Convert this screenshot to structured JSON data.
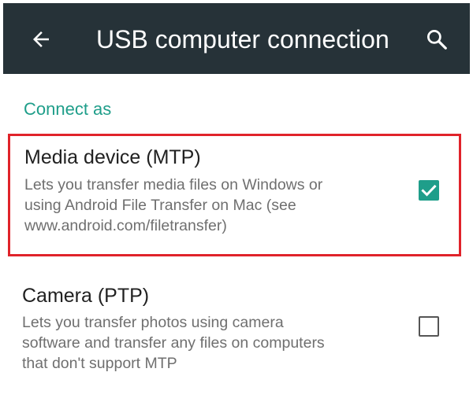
{
  "app_bar": {
    "title": "USB computer connection",
    "back_icon": "arrow-back-icon",
    "search_icon": "search-icon",
    "background_color": "#263238"
  },
  "section": {
    "header": "Connect as",
    "accent_color": "#1f9e8a"
  },
  "options": [
    {
      "title": "Media device (MTP)",
      "description": "Lets you transfer media files on Windows or\nusing Android File Transfer on Mac (see\nwww.android.com/filetransfer)",
      "checked": true,
      "highlighted": true,
      "highlight_color": "#e0232a"
    },
    {
      "title": "Camera (PTP)",
      "description": "Lets you transfer photos using camera\nsoftware and transfer any files on computers\nthat don't support MTP",
      "checked": false,
      "highlighted": false
    }
  ]
}
